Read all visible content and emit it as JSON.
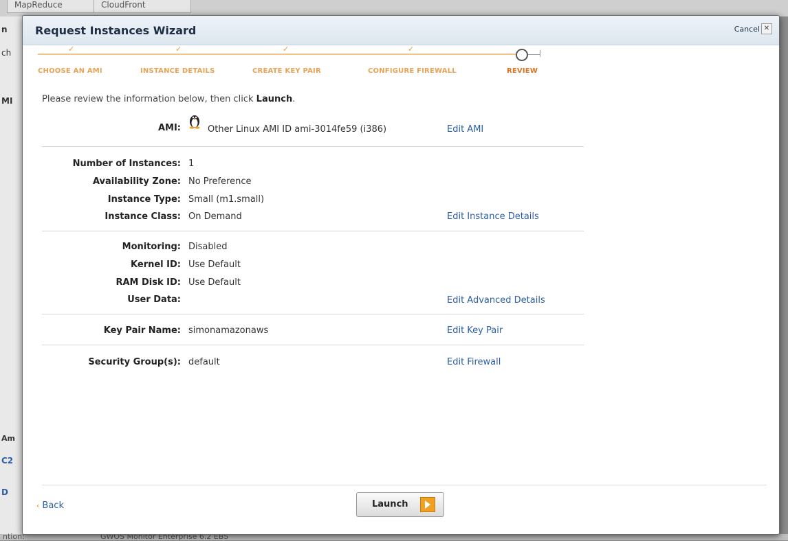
{
  "background": {
    "tabs": [
      "MapReduce",
      "CloudFront"
    ],
    "left_fragments": [
      "n",
      "ch",
      "MI",
      "Am",
      "C2",
      "D"
    ],
    "bottom_fragments": [
      "ntion:",
      "GWOS Monitor Enterprise 6.2 EBS"
    ]
  },
  "dialog": {
    "title": "Request Instances Wizard",
    "cancel_label": "Cancel",
    "close_glyph": "✕"
  },
  "steps": [
    {
      "label": "CHOOSE AN AMI",
      "done": true
    },
    {
      "label": "INSTANCE DETAILS",
      "done": true
    },
    {
      "label": "CREATE KEY PAIR",
      "done": true
    },
    {
      "label": "CONFIGURE FIREWALL",
      "done": true
    },
    {
      "label": "REVIEW",
      "current": true
    }
  ],
  "step_check_glyph": "✓",
  "intro": {
    "text_before": "Please review the information below, then click ",
    "text_bold": "Launch",
    "text_after": "."
  },
  "review": {
    "ami": {
      "label": "AMI:",
      "value": "Other Linux AMI ID ami-3014fe59 (i386)",
      "link": "Edit AMI",
      "icon": "linux-tux-icon"
    },
    "instance": {
      "rows": [
        {
          "label": "Number of Instances:",
          "value": "1"
        },
        {
          "label": "Availability Zone:",
          "value": "No Preference"
        },
        {
          "label": "Instance Type:",
          "value": "Small (m1.small)"
        },
        {
          "label": "Instance Class:",
          "value": "On Demand"
        }
      ],
      "link": "Edit Instance Details"
    },
    "advanced": {
      "rows": [
        {
          "label": "Monitoring:",
          "value": "Disabled"
        },
        {
          "label": "Kernel ID:",
          "value": "Use Default"
        },
        {
          "label": "RAM Disk ID:",
          "value": "Use Default"
        },
        {
          "label": "User Data:",
          "value": ""
        }
      ],
      "link": "Edit Advanced Details"
    },
    "keypair": {
      "label": "Key Pair Name:",
      "value": "simonamazonaws",
      "link": "Edit Key Pair"
    },
    "security": {
      "label": "Security Group(s):",
      "value": "default",
      "link": "Edit Firewall"
    }
  },
  "footer": {
    "back_glyph": "‹",
    "back_label": "Back",
    "launch_label": "Launch"
  },
  "colors": {
    "accent_orange": "#f0a023",
    "link_blue": "#2b5ea8",
    "step_orange": "#e8a255"
  }
}
